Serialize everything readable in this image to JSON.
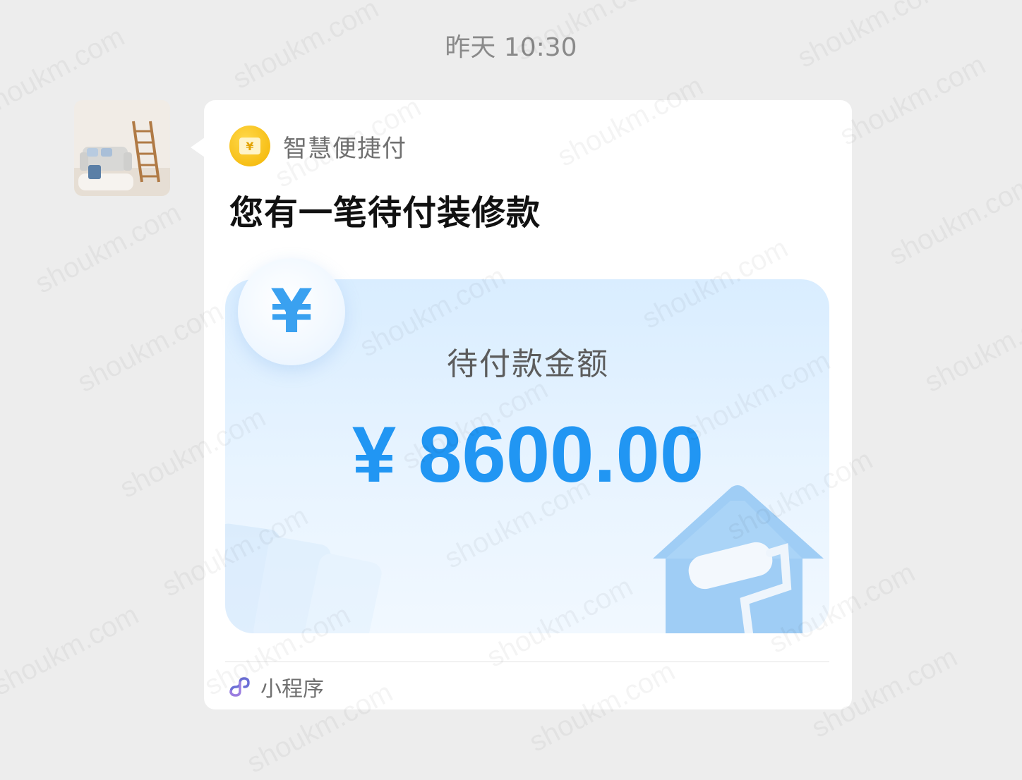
{
  "chat": {
    "timestamp": "昨天 10:30",
    "message": {
      "app_name": "智慧便捷付",
      "app_icon": "yen-wallet-icon",
      "title": "您有一笔待付装修款",
      "amount_label": "待付款金额",
      "amount_value": "¥ 8600.00",
      "footer_label": "小程序",
      "footer_icon": "mini-program-icon"
    }
  },
  "watermark": {
    "text": "shoukm.com"
  },
  "colors": {
    "background": "#ededed",
    "bubble": "#ffffff",
    "amount": "#2196f3",
    "app_logo": "#f3b400",
    "mini_program_icon": "#6b6fd6"
  }
}
